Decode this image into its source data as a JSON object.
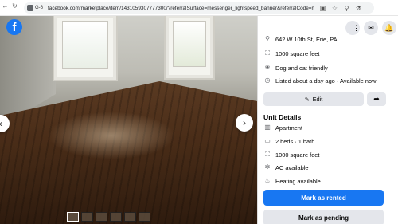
{
  "browser": {
    "tab_label": "G-6",
    "url": "facebook.com/marketplace/item/1431059307777300/?referralSurface=messenger_lightspeed_banner&referralCode=messen..."
  },
  "photo": {
    "facebook_logo": "f"
  },
  "details": {
    "address": "642 W 10th St, Erie, PA",
    "area": "1000 square feet",
    "pets": "Dog and cat friendly",
    "listed": "Listed about a day ago · Available now"
  },
  "actions": {
    "edit_label": "Edit"
  },
  "unit_details": {
    "title": "Unit Details",
    "type": "Apartment",
    "beds_baths": "2 beds · 1 bath",
    "area": "1000 square feet",
    "ac": "AC available",
    "heating": "Heating available"
  },
  "buttons": {
    "mark_rented": "Mark as rented",
    "mark_pending": "Mark as pending"
  },
  "colors": {
    "accent": "#1877f2",
    "button_gray": "#e4e6eb"
  }
}
